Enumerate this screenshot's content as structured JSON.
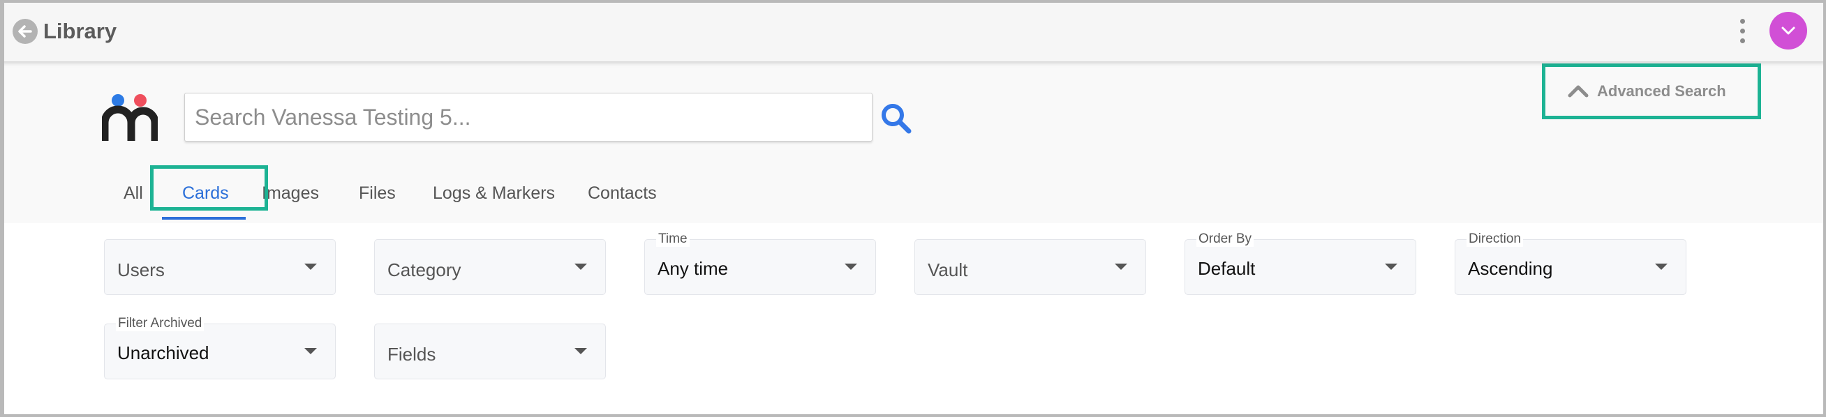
{
  "header": {
    "title": "Library",
    "back_icon": "arrow-left-icon",
    "menu_icon": "more-vertical-icon",
    "avatar_icon": "chevron-down-icon",
    "avatar_color": "#d14fd6"
  },
  "search": {
    "placeholder": "Search Vanessa Testing 5...",
    "value": "",
    "button_icon": "search-icon",
    "accent": "#3478e8"
  },
  "advanced_search": {
    "label": "Advanced Search",
    "icon": "chevron-up-icon",
    "highlight_color": "#1db394"
  },
  "tabs": [
    {
      "label": "All",
      "active": false
    },
    {
      "label": "Cards",
      "active": true
    },
    {
      "label": "Images",
      "active": false
    },
    {
      "label": "Files",
      "active": false
    },
    {
      "label": "Logs & Markers",
      "active": false
    },
    {
      "label": "Contacts",
      "active": false
    }
  ],
  "filters": [
    {
      "label": "",
      "value": "Users"
    },
    {
      "label": "",
      "value": "Category"
    },
    {
      "label": "Time",
      "value": "Any time"
    },
    {
      "label": "",
      "value": "Vault"
    },
    {
      "label": "Order By",
      "value": "Default"
    },
    {
      "label": "Direction",
      "value": "Ascending"
    },
    {
      "label": "Filter Archived",
      "value": "Unarchived"
    },
    {
      "label": "",
      "value": "Fields"
    }
  ]
}
